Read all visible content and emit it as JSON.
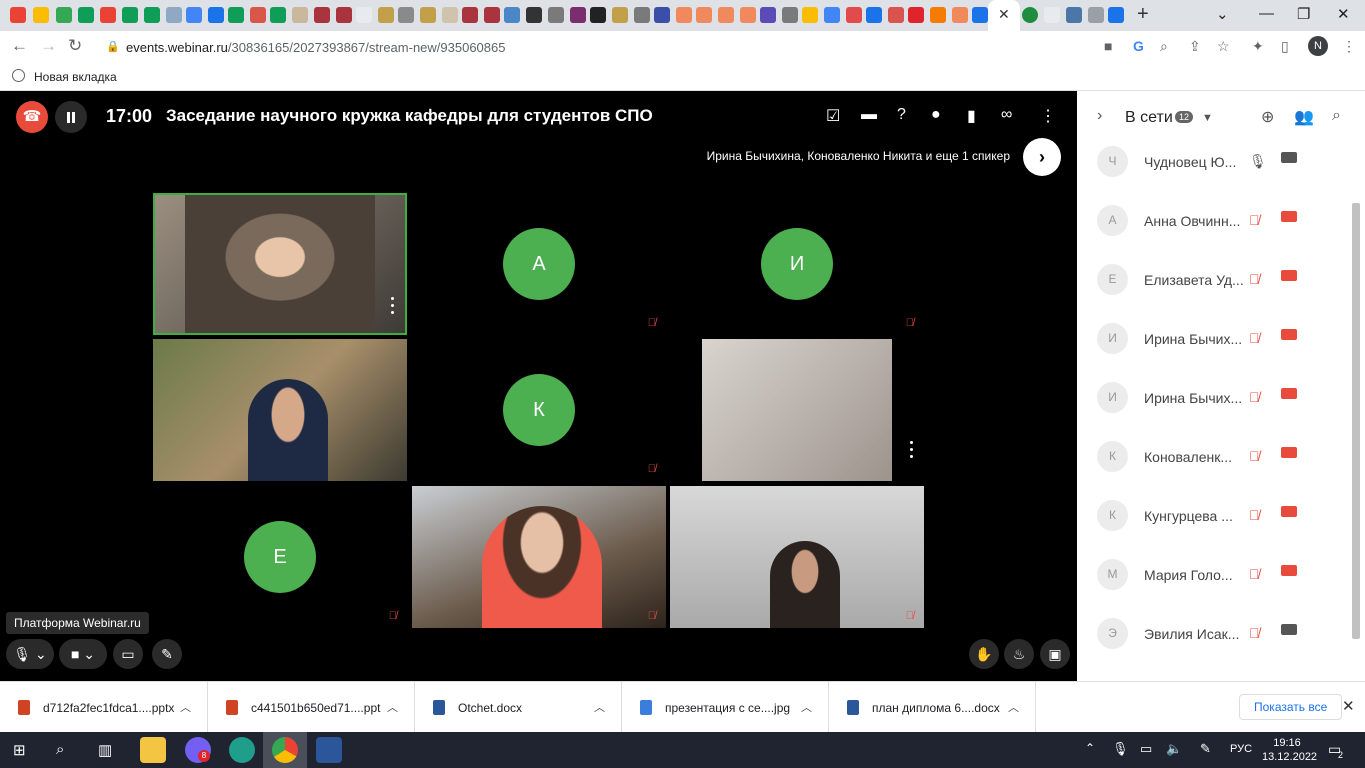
{
  "browser": {
    "url_host": "events.webinar.ru",
    "url_path": "/30836165/2027393867/stream-new/935060865",
    "bookmark": "Новая вкладка",
    "profile_initial": "N"
  },
  "webinar": {
    "time": "17:00",
    "title": "Заседание научного кружка кафедры для студентов СПО",
    "speakers_line": "Ирина Бычихина, Коноваленко Никита и еще 1 спикер",
    "platform_label": "Платформа Webinar.ru",
    "tiles": [
      {
        "type": "video",
        "active": true
      },
      {
        "type": "avatar",
        "letter": "А"
      },
      {
        "type": "avatar",
        "letter": "И"
      },
      {
        "type": "video"
      },
      {
        "type": "avatar",
        "letter": "К"
      },
      {
        "type": "video"
      },
      {
        "type": "avatar",
        "letter": "Е"
      },
      {
        "type": "video"
      },
      {
        "type": "video"
      }
    ]
  },
  "sidebar": {
    "title": "В сети",
    "count": "12",
    "participants": [
      {
        "initial": "Ч",
        "name": "Чудновец Ю...",
        "mic": "on",
        "cam": "on"
      },
      {
        "initial": "А",
        "name": "Анна Овчинн...",
        "mic": "off",
        "cam": "off"
      },
      {
        "initial": "Е",
        "name": "Елизавета Уд...",
        "mic": "off",
        "cam": "off"
      },
      {
        "initial": "И",
        "name": "Ирина Бычих...",
        "mic": "off",
        "cam": "off"
      },
      {
        "initial": "И",
        "name": "Ирина Бычих...",
        "mic": "off",
        "cam": "off"
      },
      {
        "initial": "К",
        "name": "Коноваленк...",
        "mic": "off",
        "cam": "off"
      },
      {
        "initial": "К",
        "name": "Кунгурцева ...",
        "mic": "off",
        "cam": "off"
      },
      {
        "initial": "М",
        "name": "Мария Голо...",
        "mic": "off",
        "cam": "off"
      },
      {
        "initial": "Э",
        "name": "Эвилия Исак...",
        "mic": "off",
        "cam": "on"
      }
    ]
  },
  "downloads": {
    "items": [
      {
        "name": "d712fa2fec1fdca1....pptx",
        "color": "#d04423"
      },
      {
        "name": "c441501b650ed71....ppt",
        "color": "#d04423"
      },
      {
        "name": "Otchet.docx",
        "color": "#2b579a"
      },
      {
        "name": "презентация с се....jpg",
        "color": "#3b7ddd"
      },
      {
        "name": "план диплома 6....docx",
        "color": "#2b579a"
      }
    ],
    "show_all": "Показать все"
  },
  "taskbar": {
    "time": "19:16",
    "date": "13.12.2022",
    "lang": "РУС",
    "notifications": "2",
    "viber_badge": "8"
  },
  "colors": {
    "accent_green": "#4caf50",
    "end_call": "#e84a3c",
    "mute_red": "#e84a3c"
  }
}
